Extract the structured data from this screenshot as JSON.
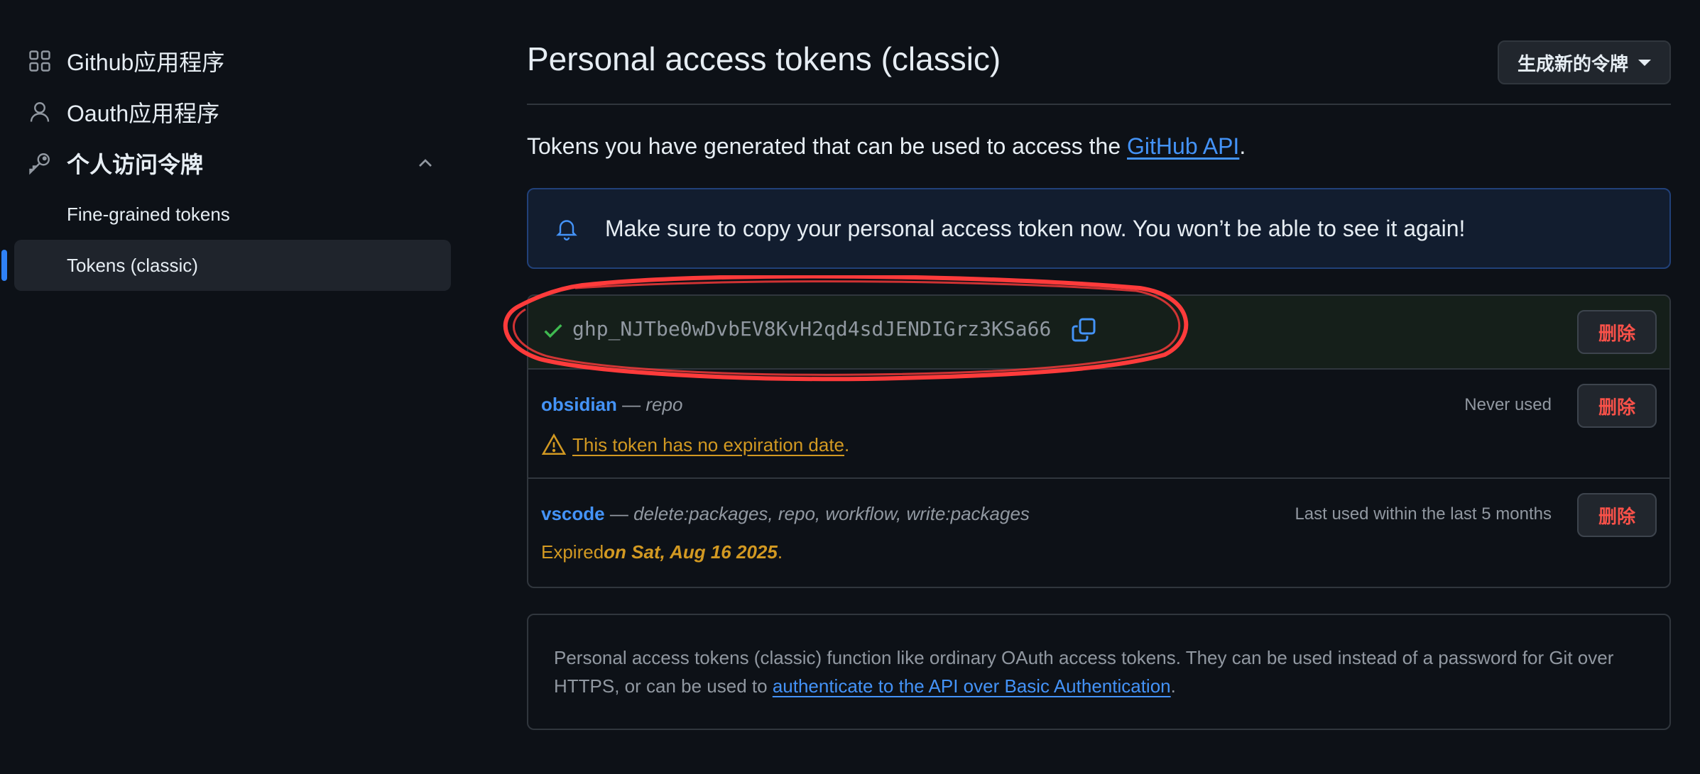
{
  "sidebar": {
    "items": [
      {
        "label": "Github应用程序",
        "icon": "apps-grid-icon"
      },
      {
        "label": "Oauth应用程序",
        "icon": "person-icon"
      },
      {
        "label": "个人访问令牌",
        "icon": "key-icon",
        "expanded": true
      }
    ],
    "sub_items": [
      {
        "label": "Fine-grained tokens",
        "active": false
      },
      {
        "label": "Tokens (classic)",
        "active": true
      }
    ]
  },
  "header": {
    "title": "Personal access tokens (classic)",
    "generate_button": "生成新的令牌"
  },
  "intro": {
    "text": "Tokens you have generated that can be used to access the ",
    "link": "GitHub API",
    "suffix": "."
  },
  "flash": {
    "message": "Make sure to copy your personal access token now. You won’t be able to see it again!",
    "icon": "bell-icon"
  },
  "new_token": {
    "value": "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",
    "delete_label": "删除"
  },
  "tokens": [
    {
      "name": "obsidian",
      "separator": " — ",
      "scopes": "repo",
      "last_used": "Never used",
      "delete_label": "删除",
      "warning": "This token has no expiration date",
      "warning_suffix": "."
    },
    {
      "name": "vscode",
      "separator": " — ",
      "scopes": "delete:packages, repo, workflow, write:packages",
      "last_used": "Last used within the last 5 months",
      "delete_label": "删除",
      "expired_prefix": "Expired ",
      "expired_date": "on Sat, Aug 16 2025",
      "expired_suffix": "."
    }
  ],
  "info": {
    "text": "Personal access tokens (classic) function like ordinary OAuth access tokens. They can be used instead of a password for Git over HTTPS, or can be used to ",
    "link": "authenticate to the API over Basic Authentication",
    "suffix": "."
  },
  "colors": {
    "background": "#0d1117",
    "accent": "#2f81f7",
    "link": "#4493f8",
    "danger": "#f85149",
    "warning": "#d29922",
    "success": "#3fb950",
    "annotation": "#ff3b3b"
  }
}
